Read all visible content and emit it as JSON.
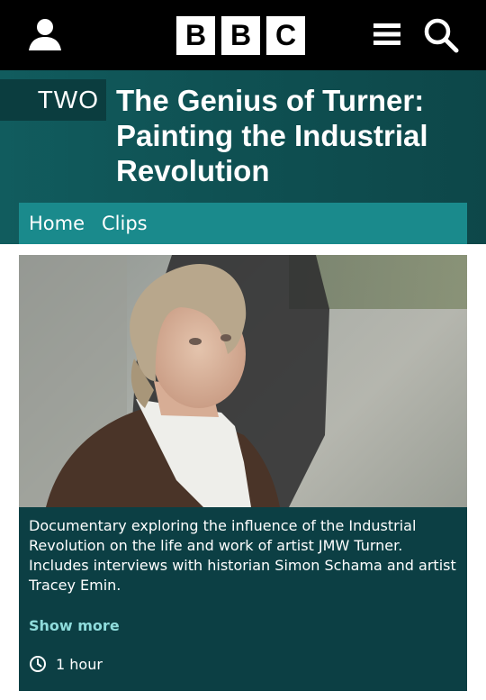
{
  "header": {
    "logo_letters": [
      "B",
      "B",
      "C"
    ],
    "icons": {
      "account": "user-icon",
      "menu": "hamburger-menu-icon",
      "search": "search-icon"
    }
  },
  "masthead": {
    "channel": "TWO",
    "title": "The Genius of Turner: Painting the Industrial Revolution"
  },
  "nav": {
    "items": [
      {
        "label": "Home"
      },
      {
        "label": "Clips"
      }
    ]
  },
  "programme": {
    "description": "Documentary exploring the influence of the Industrial Revolution on the life and work of artist JMW Turner. Includes interviews with historian Simon Schama and artist Tracey Emin.",
    "show_more": "Show more",
    "duration": "1 hour",
    "duration_icon": "clock-icon"
  },
  "colors": {
    "topbar": "#000000",
    "masthead": "#115c5e",
    "nav": "#1a8a8c",
    "card": "#0c3f44",
    "link": "#8fdcdc"
  }
}
